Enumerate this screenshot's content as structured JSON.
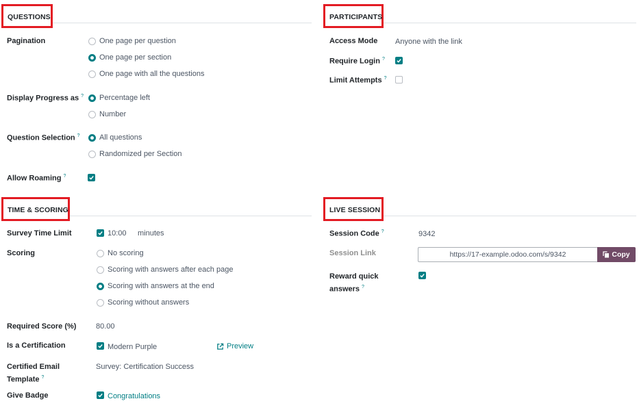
{
  "questions": {
    "title": "QUESTIONS",
    "pagination_label": "Pagination",
    "pagination_options": [
      "One page per question",
      "One page per section",
      "One page with all the questions"
    ],
    "pagination_selected": "One page per section",
    "progress_label": "Display Progress as",
    "progress_options": [
      "Percentage left",
      "Number"
    ],
    "progress_selected": "Percentage left",
    "selection_label": "Question Selection",
    "selection_options": [
      "All questions",
      "Randomized per Section"
    ],
    "selection_selected": "All questions",
    "roaming_label": "Allow Roaming",
    "roaming_checked": true,
    "help_mark": "?"
  },
  "participants": {
    "title": "PARTICIPANTS",
    "access_mode_label": "Access Mode",
    "access_mode_value": "Anyone with the link",
    "require_login_label": "Require Login",
    "require_login_checked": true,
    "limit_attempts_label": "Limit Attempts",
    "limit_attempts_checked": false
  },
  "time_scoring": {
    "title": "TIME & SCORING",
    "time_limit_label": "Survey Time Limit",
    "time_limit_checked": true,
    "time_limit_value": "10:00",
    "time_limit_unit": "minutes",
    "scoring_label": "Scoring",
    "scoring_options": [
      "No scoring",
      "Scoring with answers after each page",
      "Scoring with answers at the end",
      "Scoring without answers"
    ],
    "scoring_selected": "Scoring with answers at the end",
    "required_score_label": "Required Score (%)",
    "required_score_value": "80.00",
    "certification_label": "Is a Certification",
    "certification_checked": true,
    "certification_value": "Modern Purple",
    "preview_label": "Preview",
    "email_template_label_1": "Certified Email",
    "email_template_label_2": "Template",
    "email_template_value": "Survey: Certification Success",
    "badge_label": "Give Badge",
    "badge_checked": true,
    "badge_value": "Congratulations"
  },
  "live_session": {
    "title": "LIVE SESSION",
    "session_code_label": "Session Code",
    "session_code_value": "9342",
    "session_link_label": "Session Link",
    "session_link_value": "https://17-example.odoo.com/s/9342",
    "copy_label": "Copy",
    "reward_label_1": "Reward quick",
    "reward_label_2": "answers",
    "reward_checked": true
  },
  "colors": {
    "accent": "#017e84",
    "brand": "#714b67",
    "highlight": "#e31b23"
  }
}
